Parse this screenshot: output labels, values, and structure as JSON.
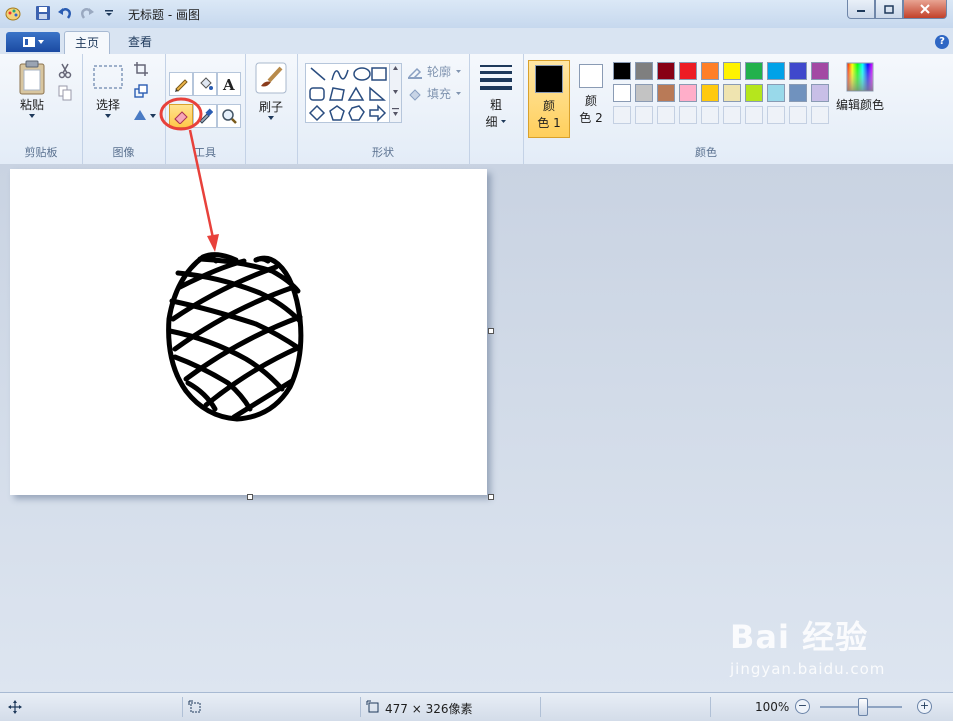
{
  "window": {
    "title": "无标题 - 画图"
  },
  "tabs": {
    "home": "主页",
    "view": "查看"
  },
  "clipboard": {
    "paste": "粘贴",
    "group": "剪贴板"
  },
  "image": {
    "select": "选择",
    "group": "图像"
  },
  "tools": {
    "group": "工具",
    "selected_tool": "eraser"
  },
  "brushes": {
    "label": "刷子"
  },
  "shapes": {
    "outline": "轮廓",
    "fill": "填充",
    "group": "形状"
  },
  "size": {
    "label_top": "粗",
    "label_bottom": "细"
  },
  "colors": {
    "color1_top": "颜",
    "color1_bottom": "色 1",
    "color2_top": "颜",
    "color2_bottom": "色 2",
    "edit": "编辑颜色",
    "group": "颜色",
    "color1_value": "#000000",
    "color2_value": "#ffffff",
    "palette": [
      "#000000",
      "#7f7f7f",
      "#880015",
      "#ed1c24",
      "#ff7f27",
      "#fff200",
      "#22b14c",
      "#00a2e8",
      "#3f48cc",
      "#a349a4",
      "#ffffff",
      "#c3c3c3",
      "#b97a57",
      "#ffaec9",
      "#ffc90e",
      "#efe4b0",
      "#b5e61d",
      "#99d9ea",
      "#7092be",
      "#c8bfe7"
    ]
  },
  "status": {
    "dimensions": "477 × 326像素",
    "zoom": "100%"
  },
  "watermark": {
    "brand": "Bai 经验",
    "url": "jingyan.baidu.com"
  },
  "accent": "#e8413b"
}
